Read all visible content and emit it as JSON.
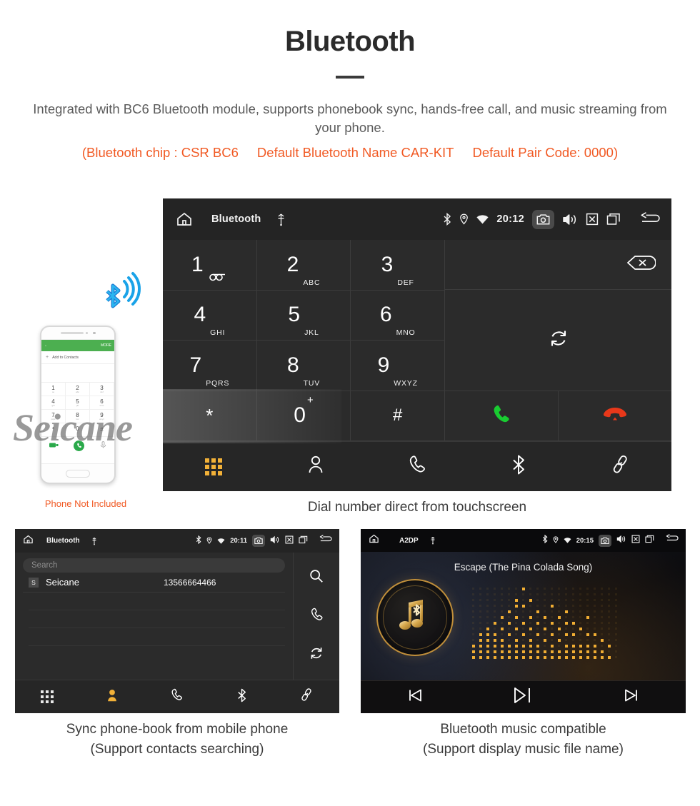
{
  "hero": {
    "title": "Bluetooth",
    "description": "Integrated with BC6 Bluetooth module, supports phonebook sync, hands-free call, and music streaming from your phone.",
    "spec_chip": "(Bluetooth chip : CSR BC6",
    "spec_name": "Default Bluetooth Name CAR-KIT",
    "spec_pair": "Default Pair Code: 0000)",
    "accent_color": "#f15a24",
    "text_color": "#5b5b5b"
  },
  "dialer": {
    "status": {
      "title": "Bluetooth",
      "time": "20:12",
      "icons": [
        "home-icon",
        "usb-icon",
        "bluetooth-icon",
        "location-icon",
        "wifi-icon",
        "camera-icon",
        "volume-icon",
        "close-icon",
        "recents-icon",
        "back-icon"
      ]
    },
    "keys": [
      {
        "num": "1",
        "sub": "",
        "voicemail": true
      },
      {
        "num": "2",
        "sub": "ABC"
      },
      {
        "num": "3",
        "sub": "DEF"
      },
      {
        "num": "4",
        "sub": "GHI"
      },
      {
        "num": "5",
        "sub": "JKL"
      },
      {
        "num": "6",
        "sub": "MNO"
      },
      {
        "num": "7",
        "sub": "PQRS"
      },
      {
        "num": "8",
        "sub": "TUV"
      },
      {
        "num": "9",
        "sub": "WXYZ"
      },
      {
        "num": "*",
        "sub": ""
      },
      {
        "num": "0",
        "sup": "+"
      },
      {
        "num": "#",
        "sub": ""
      }
    ],
    "actions": {
      "backspace": "backspace-icon",
      "sync": "sync-icon",
      "call": "call-icon",
      "hangup": "hangup-icon",
      "call_color": "#19cc31",
      "hangup_color": "#e8381a"
    },
    "nav": [
      {
        "name": "keypad",
        "icon": "keypad-icon",
        "active": true
      },
      {
        "name": "contacts",
        "icon": "contact-icon",
        "active": false
      },
      {
        "name": "call-log",
        "icon": "phone-icon",
        "active": false
      },
      {
        "name": "bluetooth",
        "icon": "bluetooth-icon",
        "active": false
      },
      {
        "name": "pair",
        "icon": "link-icon",
        "active": false
      }
    ],
    "active_color": "#f2b138",
    "caption": "Dial number direct from touchscreen"
  },
  "watermark": {
    "text": "Seicane"
  },
  "phone_mock": {
    "header_action": "MORE",
    "add_contact": "Add to Contacts",
    "keys": [
      {
        "n": "1",
        "s": "oo"
      },
      {
        "n": "2",
        "s": "abc"
      },
      {
        "n": "3",
        "s": "def"
      },
      {
        "n": "4",
        "s": "ghi"
      },
      {
        "n": "5",
        "s": "jkl"
      },
      {
        "n": "6",
        "s": "mno"
      },
      {
        "n": "7",
        "s": "pqrs"
      },
      {
        "n": "8",
        "s": "tuv"
      },
      {
        "n": "9",
        "s": "wxyz"
      },
      {
        "n": "*",
        "s": ""
      },
      {
        "n": "0",
        "s": "+"
      },
      {
        "n": "#",
        "s": ""
      }
    ],
    "not_included": "Phone Not Included",
    "bluetooth_color": "#1aa3e8"
  },
  "phonebook": {
    "status": {
      "title": "Bluetooth",
      "time": "20:11"
    },
    "search_placeholder": "Search",
    "contacts": [
      {
        "badge": "S",
        "name": "Seicane",
        "number": "13566664466"
      }
    ],
    "side_actions": [
      "search-icon",
      "phone-icon",
      "sync-icon"
    ],
    "nav": [
      {
        "name": "keypad",
        "icon": "keypad-icon",
        "active": false
      },
      {
        "name": "contacts",
        "icon": "contact-icon",
        "active": true
      },
      {
        "name": "call-log",
        "icon": "phone-icon",
        "active": false
      },
      {
        "name": "bluetooth",
        "icon": "bluetooth-icon",
        "active": false
      },
      {
        "name": "pair",
        "icon": "link-icon",
        "active": false
      }
    ],
    "caption_line1": "Sync phone-book from mobile phone",
    "caption_line2": "(Support contacts searching)"
  },
  "music": {
    "status": {
      "title": "A2DP",
      "time": "20:15"
    },
    "song_title": "Escape (The Pina Colada Song)",
    "controls": [
      "previous-icon",
      "play-pause-icon",
      "next-icon"
    ],
    "accent_color": "#d49a3e",
    "caption_line1": "Bluetooth music compatible",
    "caption_line2": "(Support display music file name)"
  }
}
